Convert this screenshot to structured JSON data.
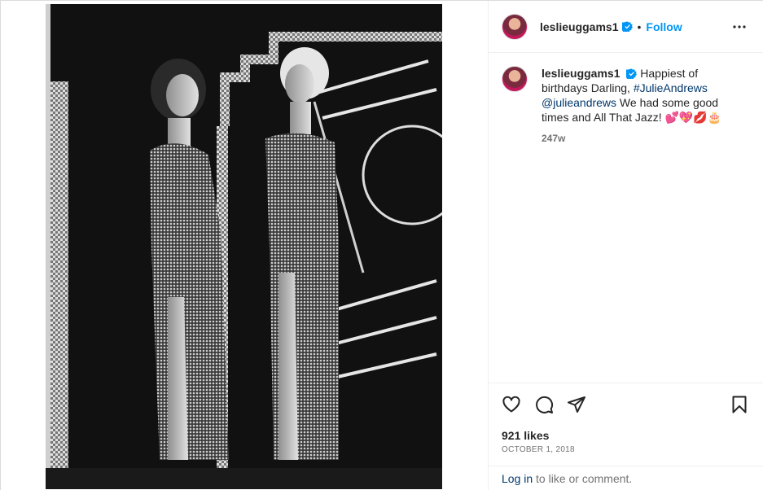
{
  "post": {
    "author": {
      "username": "leslieuggams1",
      "verified": true,
      "follow_label": "Follow",
      "separator": "•"
    },
    "caption": {
      "username": "leslieuggams1",
      "text_part1": " Happiest of birthdays Darling, ",
      "hashtag": "#JulieAndrews",
      "space": " ",
      "mention": "@julieandrews",
      "text_part2": " We had some good times and All That Jazz! ",
      "emojis": "💕💖💋🎂",
      "time_ago": "247w"
    },
    "likes": "921 likes",
    "date": "OCTOBER 1, 2018",
    "login_prompt": {
      "link": "Log in",
      "text": " to like or comment."
    },
    "icons": {
      "more": "more-options-icon",
      "like": "heart-icon",
      "comment": "comment-icon",
      "share": "share-icon",
      "save": "bookmark-icon",
      "verified": "verified-badge-icon"
    },
    "colors": {
      "accent": "#0095f6",
      "link": "#00376b",
      "secondary_text": "#737373",
      "verified_badge": "#0095f6"
    }
  }
}
